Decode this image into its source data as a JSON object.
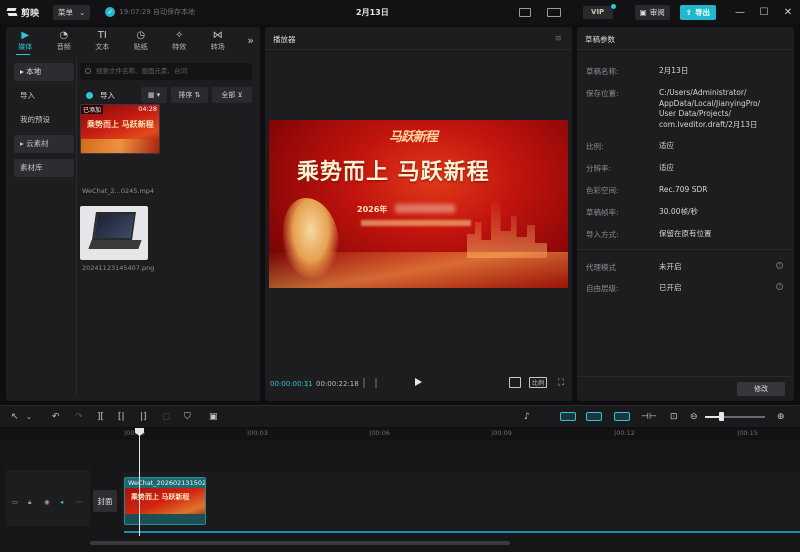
{
  "titlebar": {
    "app_name": "剪映",
    "menu_label": "菜单",
    "save_status": "19:07:29 自动保存本地",
    "title": "2月13日",
    "vip_label": "VIP",
    "review_label": "审阅",
    "export_label": "导出",
    "minimize_glyph": "—",
    "maximize_glyph": "☐",
    "close_glyph": "✕"
  },
  "left_panel": {
    "tabs": [
      {
        "icon": "media-icon",
        "glyph": "▶",
        "label": "媒体"
      },
      {
        "icon": "audio-icon",
        "glyph": "◔",
        "label": "音频"
      },
      {
        "icon": "text-icon",
        "glyph": "TI",
        "label": "文本"
      },
      {
        "icon": "sticker-icon",
        "glyph": "◷",
        "label": "贴纸"
      },
      {
        "icon": "effects-icon",
        "glyph": "✧",
        "label": "特效"
      },
      {
        "icon": "transition-icon",
        "glyph": "⋈",
        "label": "转场"
      }
    ],
    "more_glyph": "»",
    "nav": [
      "▸ 本地",
      "导入",
      "我的预设",
      "▸ 云素材",
      "素材库"
    ],
    "search_placeholder": "搜索文件名称、画面元素、台词",
    "import_label": "导入",
    "grid_glyph": "▦ ▾",
    "sort_label": "排序 ⇅",
    "all_label": "全部 ⊻",
    "section_all": "全部",
    "media": [
      {
        "name": "WeChat_2...0245.mp4",
        "added_badge": "已添加",
        "duration": "04:28",
        "overlay_text": "乘势而上 马跃新程"
      },
      {
        "name": "20241123145407.png"
      }
    ]
  },
  "player": {
    "title": "播放器",
    "menu_glyph": "≡",
    "frame_calligraphy": "马跃新程",
    "frame_title": "乘势而上 马跃新程",
    "frame_year": "2026年",
    "current_time": "00:00:00:11",
    "total_time": "00:00:22:18",
    "ratio_label": "比例",
    "full_glyph": "⛶"
  },
  "draft": {
    "title": "草稿参数",
    "rows": [
      {
        "key": "草稿名称:",
        "value": "2月13日"
      },
      {
        "key": "保存位置:",
        "value": "C:/Users/Administrator/\nAppData/Local/JianyingPro/\nUser Data/Projects/\ncom.lveditor.draft/2月13日"
      },
      {
        "key": "比例:",
        "value": "适应"
      },
      {
        "key": "分辨率:",
        "value": "适应"
      },
      {
        "key": "色彩空间:",
        "value": "Rec.709 SDR"
      },
      {
        "key": "草稿帧率:",
        "value": "30.00帧/秒"
      },
      {
        "key": "导入方式:",
        "value": "保留在原有位置"
      },
      {
        "key": "代理模式",
        "value": "未开启"
      },
      {
        "key": "自由层级:",
        "value": "已开启"
      }
    ],
    "modify_label": "修改"
  },
  "timeline": {
    "ruler": [
      "|00:00",
      "|00:03",
      "|00:06",
      "|00:09",
      "|00:12",
      "|00:15"
    ],
    "cover_label": "封面",
    "clip_name": "WeChat_202602131502",
    "clip_text": "乘势而上 马跃新程"
  }
}
